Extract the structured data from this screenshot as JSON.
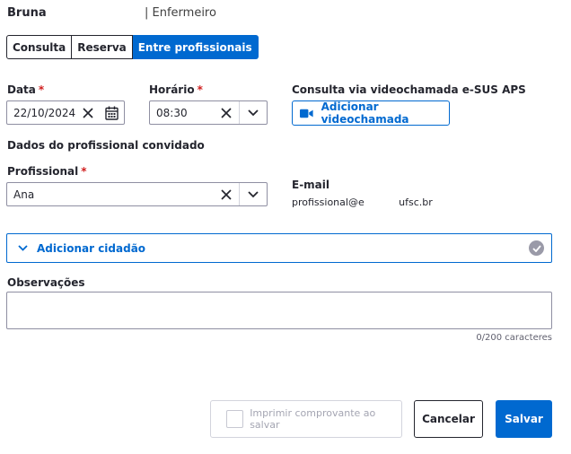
{
  "header": {
    "name": "Bruna",
    "role": "| Enfermeiro"
  },
  "tabs": [
    {
      "label": "Consulta",
      "active": false
    },
    {
      "label": "Reserva",
      "active": false
    },
    {
      "label": "Entre profissionais",
      "active": true
    }
  ],
  "date": {
    "label": "Data",
    "required": "*",
    "value": "22/10/2024",
    "clear_icon": "close-icon",
    "picker_icon": "calendar-icon"
  },
  "time": {
    "label": "Horário",
    "required": "*",
    "value": "08:30",
    "clear_icon": "close-icon",
    "dropdown_icon": "chevron-down-icon"
  },
  "video": {
    "label": "Consulta via videochamada e-SUS APS",
    "button_label": "Adicionar videochamada",
    "icon": "video-camera-icon"
  },
  "invited": {
    "section_title": "Dados do profissional convidado",
    "professional_label": "Profissional",
    "required": "*",
    "professional_value": "Ana",
    "email_label": "E-mail",
    "email_value": "profissional@e           ufsc.br"
  },
  "citizen": {
    "label": "Adicionar cidadão",
    "icon": "chevron-down-icon",
    "status_icon": "check-circle-icon"
  },
  "observations": {
    "label": "Observações",
    "value": "",
    "counter": "0/200 caracteres"
  },
  "footer": {
    "print_label": "Imprimir comprovante ao salvar",
    "cancel_label": "Cancelar",
    "save_label": "Salvar"
  },
  "colors": {
    "primary": "#0069d0",
    "required": "#d01e1e",
    "border": "#8f8fa2",
    "text": "#24252e"
  }
}
